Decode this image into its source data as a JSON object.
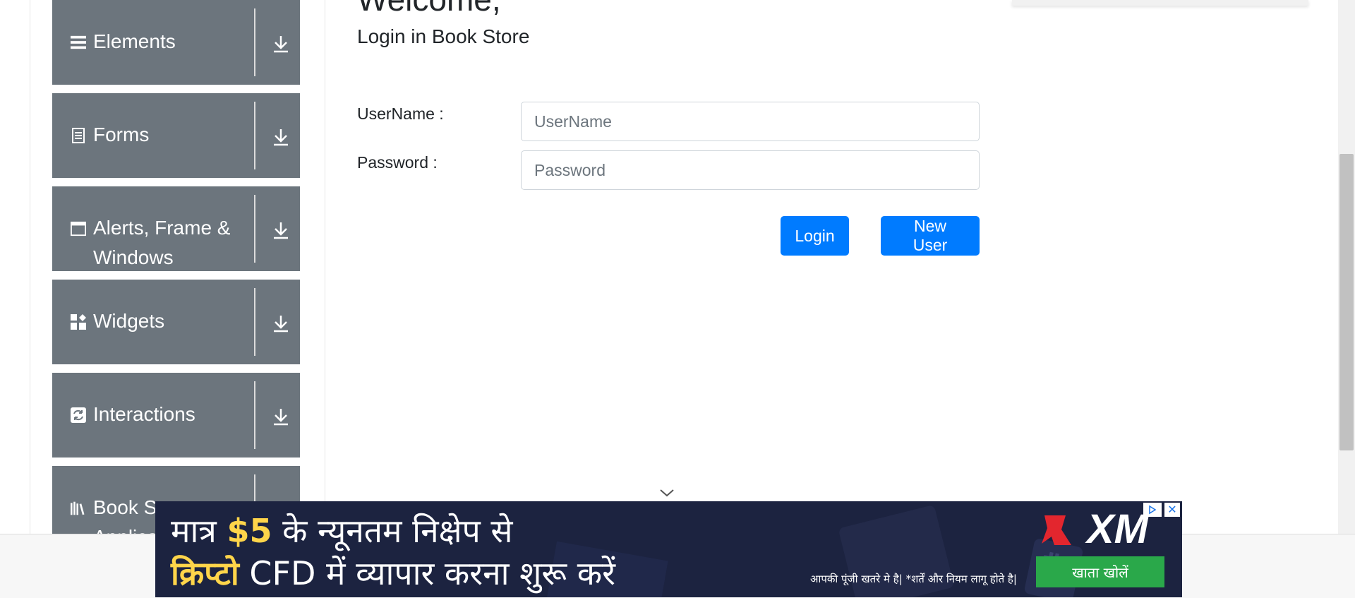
{
  "sidebar": {
    "groups": [
      {
        "label": "Elements",
        "icon": "list-icon"
      },
      {
        "label": "Forms",
        "icon": "form-icon"
      },
      {
        "label": "Alerts, Frame & Windows",
        "icon": "window-icon"
      },
      {
        "label": "Widgets",
        "icon": "widgets-icon"
      },
      {
        "label": "Interactions",
        "icon": "interactions-icon"
      },
      {
        "label": "Book Store Application",
        "icon": "books-icon"
      }
    ]
  },
  "main": {
    "welcome": "Welcome,",
    "subtitle": "Login in Book Store",
    "username_label": "UserName :",
    "username_placeholder": "UserName",
    "username_value": "",
    "password_label": "Password :",
    "password_placeholder": "Password",
    "password_value": "",
    "login_button": "Login",
    "new_user_button": "New User"
  },
  "ad": {
    "line1_pre": "मात्र ",
    "line1_amount": "$5",
    "line1_post": " के न्यूनतम निक्षेप से",
    "line2_highlight": "क्रिप्टो",
    "line2_rest": " CFD में  व्यापार करना शुरू करें",
    "disclaimer": "आपकी पूंजी खतरे मे है| *शर्तें और नियम लागू होते है|",
    "brand": "XM",
    "cta": "खाता खोलें",
    "close": "✕"
  },
  "colors": {
    "sidebar_bg": "#6c757d",
    "primary": "#007bff",
    "ad_bg": "#1c2340",
    "ad_highlight": "#ffd54a",
    "ad_cta": "#2aa84a",
    "ad_brand_red": "#e3262e"
  }
}
